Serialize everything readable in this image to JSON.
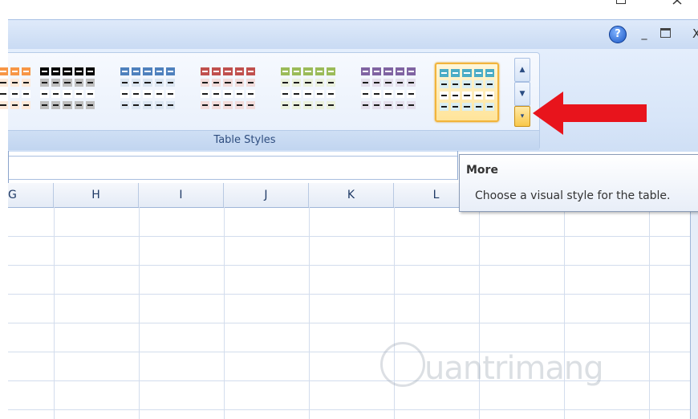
{
  "window": {
    "help_symbol": "?",
    "minimize_symbol": "_",
    "close_symbol": "X"
  },
  "ribbon": {
    "group_label": "Table Styles",
    "styles": [
      {
        "name": "orange-partial",
        "head": "#f79646",
        "band": "#fde9d9"
      },
      {
        "name": "black",
        "head": "#000000",
        "band": "#bfbfbf"
      },
      {
        "name": "blue",
        "head": "#4f81bd",
        "band": "#dce6f1"
      },
      {
        "name": "red",
        "head": "#c0504d",
        "band": "#f2dcdb"
      },
      {
        "name": "green",
        "head": "#9bbb59",
        "band": "#ebf1de"
      },
      {
        "name": "purple",
        "head": "#8064a2",
        "band": "#e4dfec"
      },
      {
        "name": "aqua",
        "head": "#4bacc6",
        "band": "#daeef3"
      }
    ],
    "scroll_up_icon": "▲",
    "scroll_down_icon": "▼",
    "more_icon": "▾"
  },
  "tooltip": {
    "title": "More",
    "description": "Choose a visual style for the table."
  },
  "sheet": {
    "columns": [
      "G",
      "H",
      "I",
      "J",
      "K",
      "L"
    ]
  },
  "watermark": {
    "text": "uantrimang"
  },
  "colors": {
    "arrow": "#e8141c",
    "selected_border": "#f2b43b"
  }
}
